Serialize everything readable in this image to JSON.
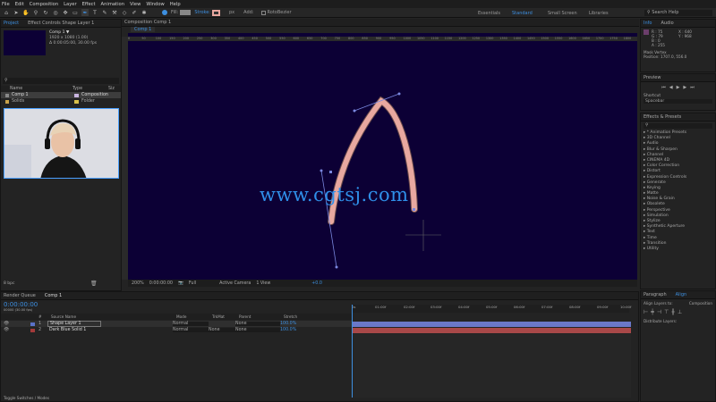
{
  "menu": [
    "File",
    "Edit",
    "Composition",
    "Layer",
    "Effect",
    "Animation",
    "View",
    "Window",
    "Help"
  ],
  "toolbar": {
    "fill_label": "Fill:",
    "stroke_label": "Stroke:",
    "stroke_px": "px",
    "add_label": "Add:",
    "rotobezier_label": "RotoBezier",
    "workspaces": [
      "Essentials",
      "Standard",
      "Small Screen",
      "Libraries"
    ],
    "search_label": "Search Help"
  },
  "project": {
    "tabs": [
      "Project",
      "Effect Controls Shape Layer 1"
    ],
    "comp_name": "Comp 1 ▼",
    "comp_size": "1920 x 1080 (1.00)",
    "comp_dur": "Δ 0:00:05:00, 30.00 fps",
    "col_name": "Name",
    "col_type": "Type",
    "col_size": "Siz",
    "items": [
      {
        "name": "Comp 1",
        "type": "Composition"
      },
      {
        "name": "Solids",
        "type": "Folder"
      }
    ],
    "bpc": "8 bpc"
  },
  "comp": {
    "header": "Composition  Comp 1",
    "tab": "Comp 1",
    "zoom": "200%",
    "timecode": "0:00:00:00",
    "quality": "Full",
    "camera": "Active Camera",
    "views": "1 View",
    "offset": "+0.0",
    "ruler": [
      "0",
      "50",
      "100",
      "150",
      "200",
      "250",
      "300",
      "350",
      "400",
      "450",
      "500",
      "550",
      "600",
      "650",
      "700",
      "750",
      "800",
      "850",
      "900",
      "950",
      "1000",
      "1050",
      "1100",
      "1150",
      "1200",
      "1250",
      "1300",
      "1350",
      "1400",
      "1450",
      "1500",
      "1550",
      "1600",
      "1650",
      "1700",
      "1750",
      "1800"
    ]
  },
  "watermark": "www.cgtsj.com",
  "info": {
    "tabs": [
      "Info",
      "Audio"
    ],
    "rgb": [
      "R : 75",
      "G : 79",
      "B : 0",
      "A : 255"
    ],
    "xy": [
      "X : 640",
      "Y : 968"
    ],
    "mask": "Mask Vertex",
    "position": "Position: 1707.0, 556.0"
  },
  "preview": {
    "title": "Preview",
    "shortcut_label": "Shortcut",
    "shortcut": "Spacebar"
  },
  "effects": {
    "title": "Effects & Presets",
    "items": [
      "* Animation Presets",
      "3D Channel",
      "Audio",
      "Blur & Sharpen",
      "Channel",
      "CINEMA 4D",
      "Color Correction",
      "Distort",
      "Expression Controls",
      "Generate",
      "Keying",
      "Matte",
      "Noise & Grain",
      "Obsolete",
      "Perspective",
      "Simulation",
      "Stylize",
      "Synthetic Aperture",
      "Text",
      "Time",
      "Transition",
      "Utility"
    ]
  },
  "paragraph": {
    "tabs": [
      "Paragraph",
      "Align"
    ],
    "align_to_label": "Align Layers to:",
    "align_to": "Composition",
    "distribute": "Distribute Layers:"
  },
  "timeline": {
    "tabs": [
      "Render Queue",
      "Comp 1"
    ],
    "timecode": "0:00:00:00",
    "frames": "00000 (30.00 fps)",
    "columns": {
      "num": "#",
      "source": "Source Name",
      "mode": "Mode",
      "trkmat": "TrkMat",
      "parent": "Parent",
      "stretch": "Stretch"
    },
    "layers": [
      {
        "num": "1",
        "name": "Shape Layer 1",
        "mode": "Normal",
        "trkmat": "",
        "parent": "None",
        "stretch": "100.0%",
        "color": "#5b72c9"
      },
      {
        "num": "2",
        "name": "Dark Blue Solid 1",
        "mode": "Normal",
        "trkmat": "None",
        "parent": "None",
        "stretch": "100.0%",
        "color": "#a33a3a"
      }
    ],
    "ruler": [
      "0s",
      "01:00f",
      "02:00f",
      "03:00f",
      "04:00f",
      "05:00f",
      "06:00f",
      "07:00f",
      "08:00f",
      "09:00f",
      "10:00f"
    ],
    "toggle": "Toggle Switches / Modes"
  },
  "colors": {
    "accent": "#3d8fe0",
    "stroke_pink": "#e8a8a0",
    "comp_bg": "#0c0035"
  }
}
